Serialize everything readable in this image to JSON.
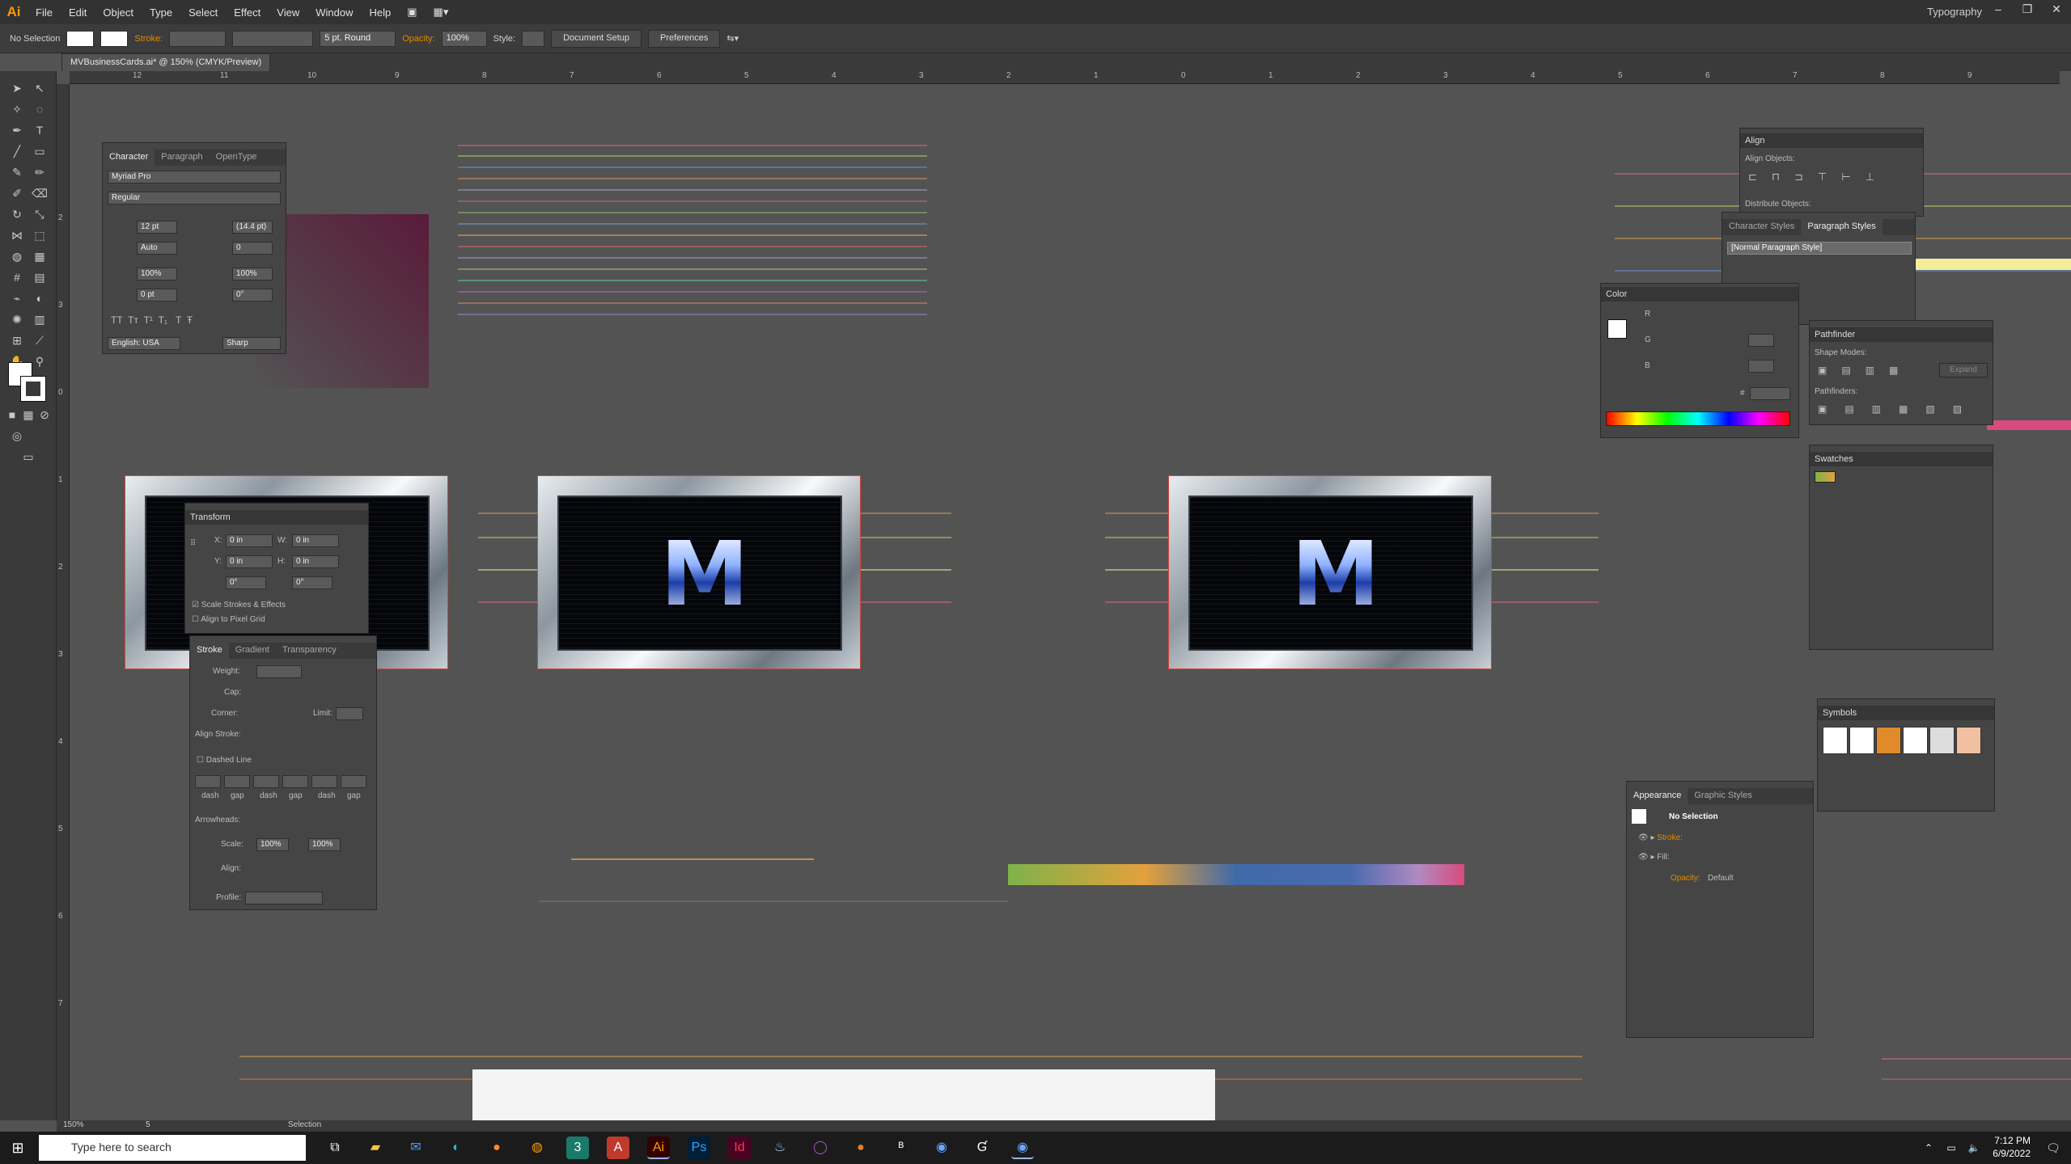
{
  "app": {
    "logo": "Ai",
    "menu": [
      "File",
      "Edit",
      "Object",
      "Type",
      "Select",
      "Effect",
      "View",
      "Window",
      "Help"
    ],
    "workspace": "Typography"
  },
  "control_bar": {
    "selection": "No Selection",
    "stroke_label": "Stroke:",
    "brush": "5 pt. Round",
    "opacity_label": "Opacity:",
    "opacity_value": "100%",
    "style_label": "Style:",
    "document_setup": "Document Setup",
    "preferences": "Preferences"
  },
  "document": {
    "tab_title": "MVBusinessCards.ai* @ 150% (CMYK/Preview)",
    "ruler_top": [
      "12",
      "11",
      "10",
      "9",
      "8",
      "7",
      "6",
      "5",
      "4",
      "3",
      "2",
      "1",
      "0",
      "1",
      "2",
      "3",
      "4",
      "5",
      "6",
      "7",
      "8",
      "9"
    ],
    "ruler_left": [
      "2",
      "3",
      "0",
      "1",
      "2",
      "3",
      "4",
      "5",
      "6",
      "7"
    ]
  },
  "character_panel": {
    "tabs": [
      "Character",
      "Paragraph",
      "OpenType"
    ],
    "font_family": "Myriad Pro",
    "font_style": "Regular",
    "size": "12 pt",
    "leading": "(14.4 pt)",
    "kerning": "Auto",
    "tracking": "0",
    "vscale": "100%",
    "hscale": "100%",
    "baseline": "0 pt",
    "rotation": "0°",
    "language": "English: USA",
    "antialias": "Sharp"
  },
  "transform_panel": {
    "title": "Transform",
    "x": "0 in",
    "y": "0 in",
    "w": "0 in",
    "h": "0 in",
    "rot": "0°",
    "shear": "0°",
    "scale_strokes": "Scale Strokes & Effects",
    "align_pixel": "Align to Pixel Grid"
  },
  "stroke_panel": {
    "tabs": [
      "Stroke",
      "Gradient",
      "Transparency"
    ],
    "weight_label": "Weight:",
    "cap_label": "Cap:",
    "corner_label": "Corner:",
    "limit_label": "Limit:",
    "align_label": "Align Stroke:",
    "dashed_label": "Dashed Line",
    "dash_labels": [
      "dash",
      "gap",
      "dash",
      "gap",
      "dash",
      "gap"
    ],
    "arrowheads_label": "Arrowheads:",
    "scale_label": "Scale:",
    "scale_1": "100%",
    "scale_2": "100%",
    "align2_label": "Align:",
    "profile_label": "Profile:"
  },
  "align_panel": {
    "title": "Align",
    "align_objects": "Align Objects:",
    "distribute_objects": "Distribute Objects:"
  },
  "styles_panel": {
    "tabs": [
      "Character Styles",
      "Paragraph Styles"
    ],
    "item": "[Normal Paragraph Style]"
  },
  "color_panel": {
    "title": "Color",
    "r": "R",
    "g": "G",
    "b": "B",
    "hash": "#"
  },
  "pathfinder_panel": {
    "title": "Pathfinder",
    "shape_modes": "Shape Modes:",
    "pathfinders": "Pathfinders:",
    "expand": "Expand"
  },
  "swatches_panel": {
    "title": "Swatches"
  },
  "symbols_panel": {
    "title": "Symbols"
  },
  "appearance_panel": {
    "tabs": [
      "Appearance",
      "Graphic Styles"
    ],
    "header": "No Selection",
    "stroke": "Stroke:",
    "fill": "Fill:",
    "opacity": "Opacity:",
    "opacity_value": "Default"
  },
  "artboards": {
    "monogram": "M"
  },
  "status_bar": {
    "zoom": "150%",
    "page": "5",
    "tool": "Selection"
  },
  "taskbar": {
    "search_placeholder": "Type here to search",
    "time": "7:12 PM",
    "date": "6/9/2022"
  },
  "colors": {
    "accent": "#ff9a00",
    "artboard_border": "#d9443b",
    "panel_bg": "#454545",
    "canvas": "#535353"
  }
}
